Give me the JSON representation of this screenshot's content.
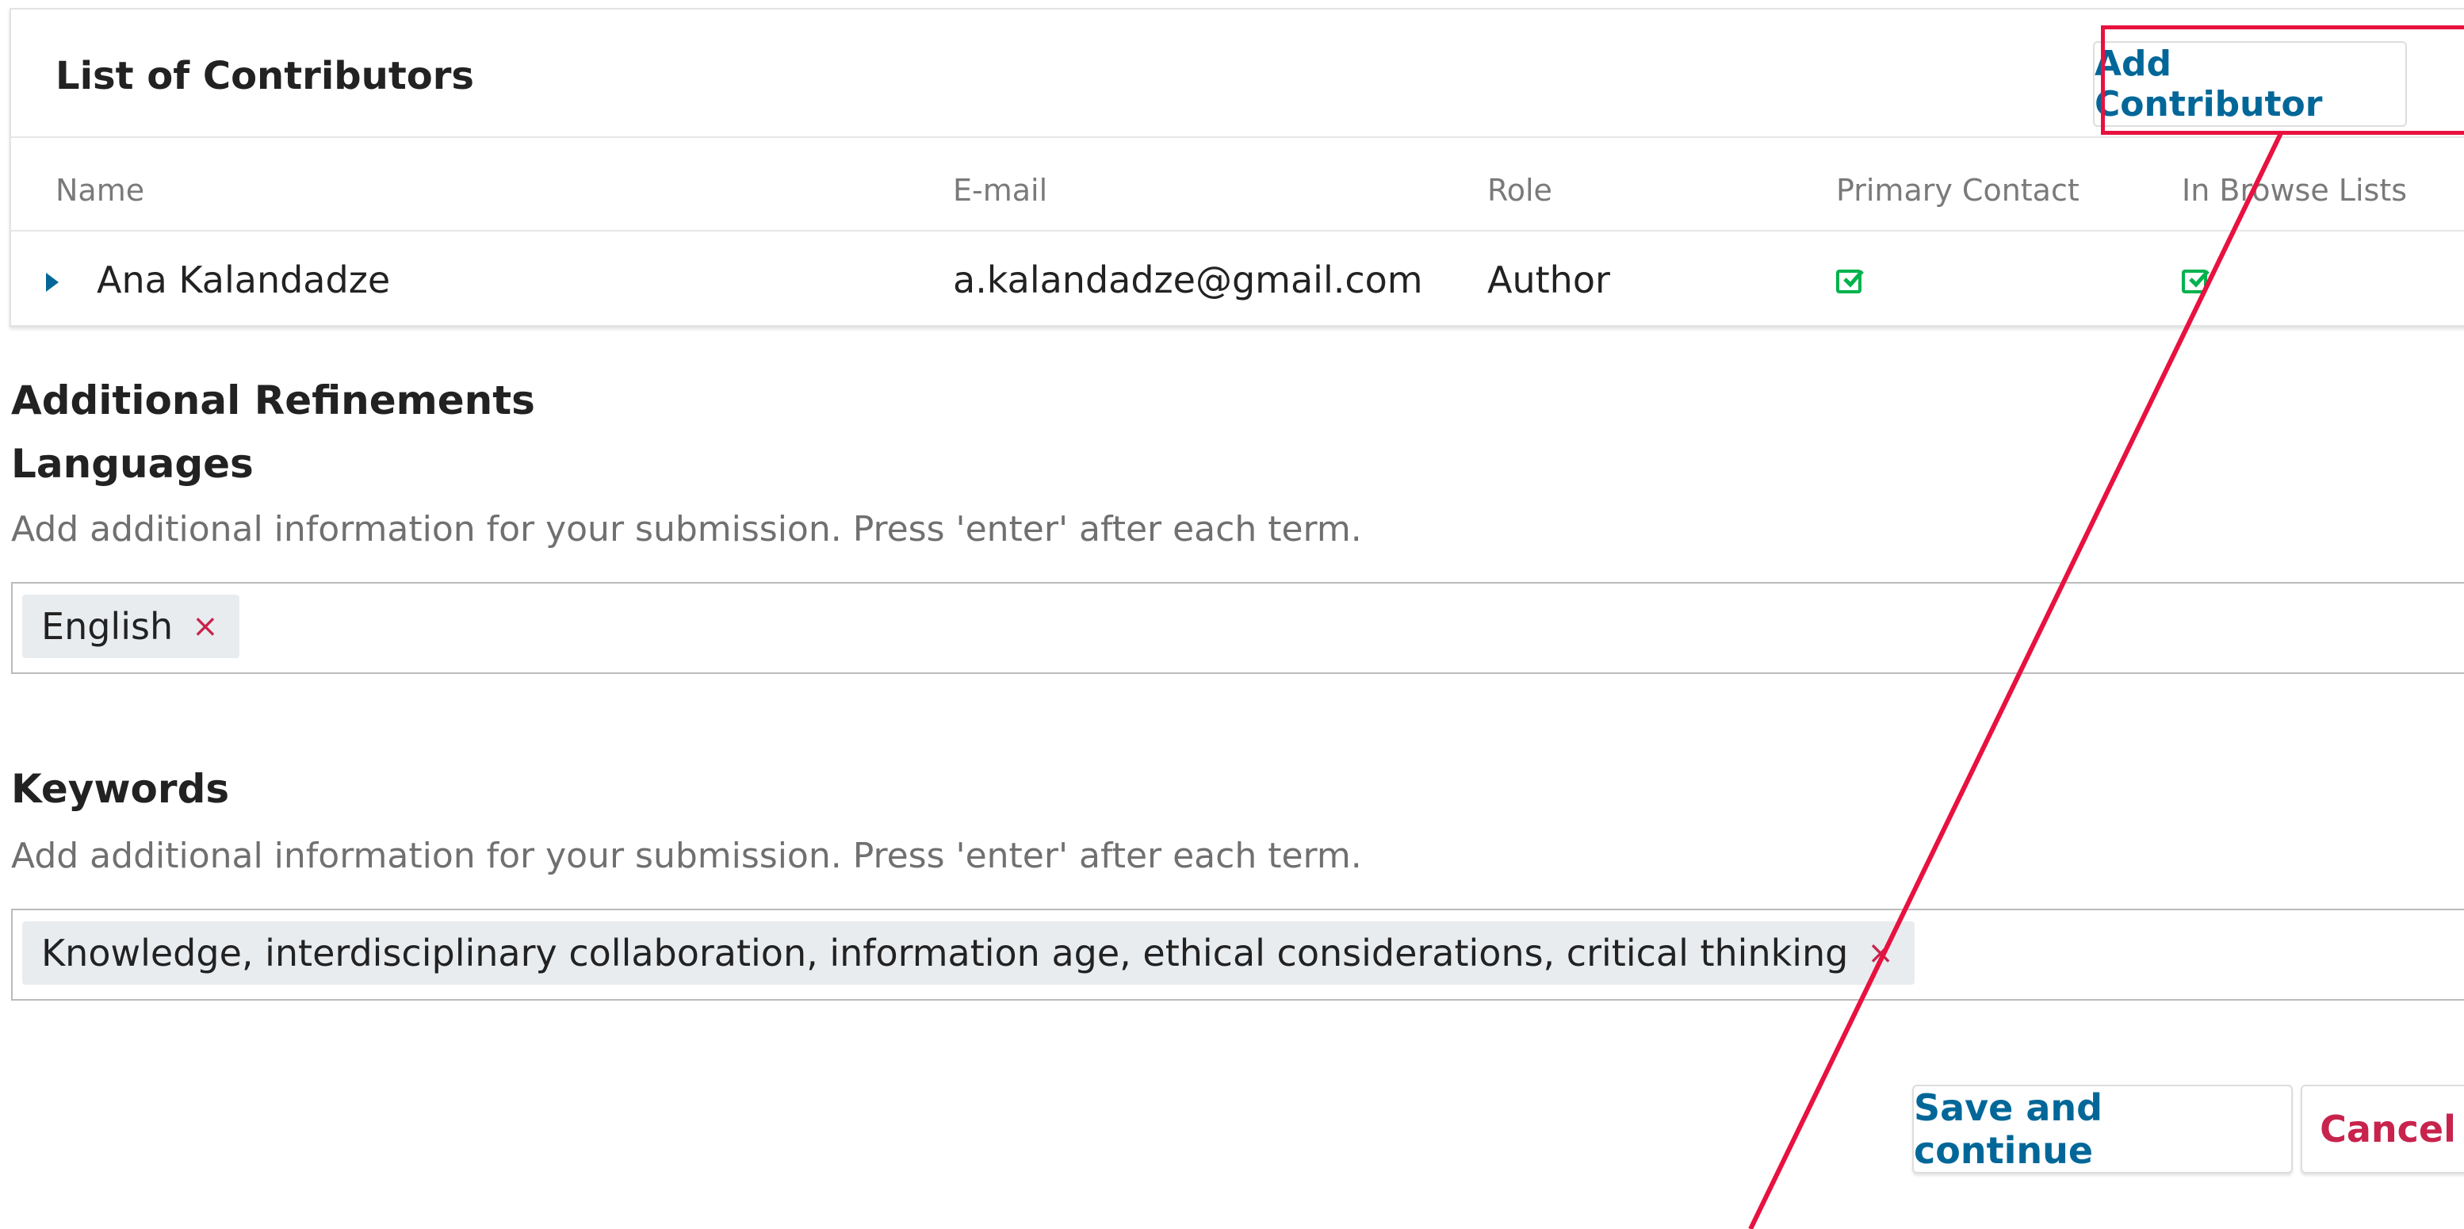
{
  "contributors": {
    "title": "List of Contributors",
    "add_button": "Add Contributor",
    "columns": [
      "Name",
      "E-mail",
      "Role",
      "Primary Contact",
      "In Browse Lists"
    ],
    "rows": [
      {
        "name": "Ana Kalandadze",
        "email": "a.kalandadze@gmail.com",
        "role": "Author",
        "primary_contact": true,
        "in_browse_lists": true
      }
    ]
  },
  "refinements": {
    "title": "Additional Refinements",
    "languages": {
      "label": "Languages",
      "help": "Add additional information for your submission. Press 'enter' after each term.",
      "tags": [
        "English"
      ]
    },
    "keywords": {
      "label": "Keywords",
      "help": "Add additional information for your submission. Press 'enter' after each term.",
      "tags": [
        "Knowledge, interdisciplinary collaboration, information age, ethical considerations, critical thinking"
      ]
    }
  },
  "actions": {
    "save": "Save and continue",
    "cancel": "Cancel"
  },
  "icons": {
    "remove_tag": "×",
    "expand": "triangle-right",
    "checked": "check-square"
  },
  "colors": {
    "link_blue": "#006798",
    "cancel_red": "#c8234d",
    "check_green": "#00b24e",
    "annotation_red": "#e8113f"
  }
}
